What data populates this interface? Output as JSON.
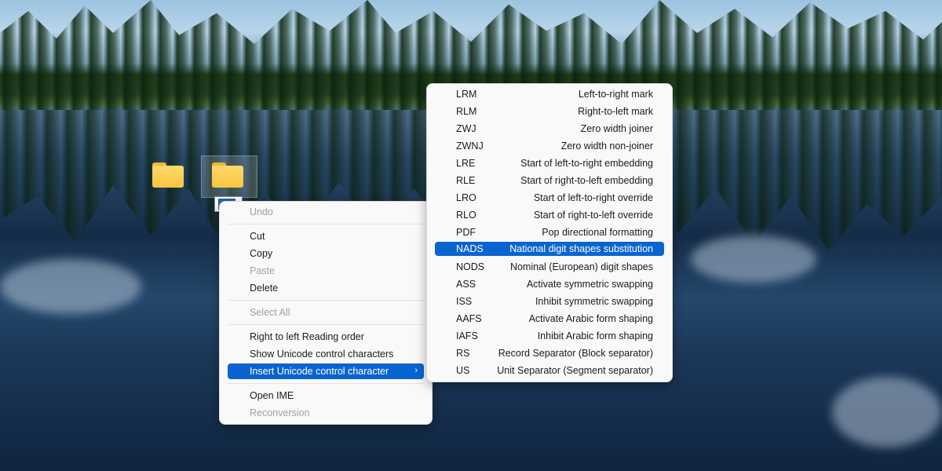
{
  "context_menu": {
    "items": [
      {
        "label": "Undo",
        "disabled": true
      },
      {
        "label": "Cut",
        "disabled": false
      },
      {
        "label": "Copy",
        "disabled": false
      },
      {
        "label": "Paste",
        "disabled": true
      },
      {
        "label": "Delete",
        "disabled": false
      },
      {
        "label": "Select All",
        "disabled": true
      },
      {
        "label": "Right to left Reading order",
        "disabled": false
      },
      {
        "label": "Show Unicode control characters",
        "disabled": false
      },
      {
        "label": "Insert Unicode control character",
        "disabled": false,
        "highlighted": true,
        "submenu_arrow": "›"
      },
      {
        "label": "Open IME",
        "disabled": false
      },
      {
        "label": "Reconversion",
        "disabled": true
      }
    ]
  },
  "submenu": {
    "items": [
      {
        "code": "LRM",
        "desc": "Left-to-right mark"
      },
      {
        "code": "RLM",
        "desc": "Right-to-left mark"
      },
      {
        "code": "ZWJ",
        "desc": "Zero width joiner"
      },
      {
        "code": "ZWNJ",
        "desc": "Zero width non-joiner"
      },
      {
        "code": "LRE",
        "desc": "Start of left-to-right embedding"
      },
      {
        "code": "RLE",
        "desc": "Start of right-to-left embedding"
      },
      {
        "code": "LRO",
        "desc": "Start of left-to-right override"
      },
      {
        "code": "RLO",
        "desc": "Start of right-to-left override"
      },
      {
        "code": "PDF",
        "desc": "Pop directional formatting"
      },
      {
        "code": "NADS",
        "desc": "National digit shapes substitution",
        "highlighted": true
      },
      {
        "code": "NODS",
        "desc": "Nominal (European) digit shapes"
      },
      {
        "code": "ASS",
        "desc": "Activate symmetric swapping"
      },
      {
        "code": "ISS",
        "desc": "Inhibit symmetric swapping"
      },
      {
        "code": "AAFS",
        "desc": "Activate Arabic form shaping"
      },
      {
        "code": "IAFS",
        "desc": "Inhibit Arabic form shaping"
      },
      {
        "code": "RS",
        "desc": "Record Separator (Block separator)"
      },
      {
        "code": "US",
        "desc": "Unit Separator (Segment separator)"
      }
    ]
  },
  "colors": {
    "accent": "#0a64d0",
    "menu_bg": "#f9f9f9",
    "disabled_text": "#a0a0a0"
  },
  "icons": [
    "folder-icon",
    "folder-icon",
    "chevron-right-icon"
  ]
}
